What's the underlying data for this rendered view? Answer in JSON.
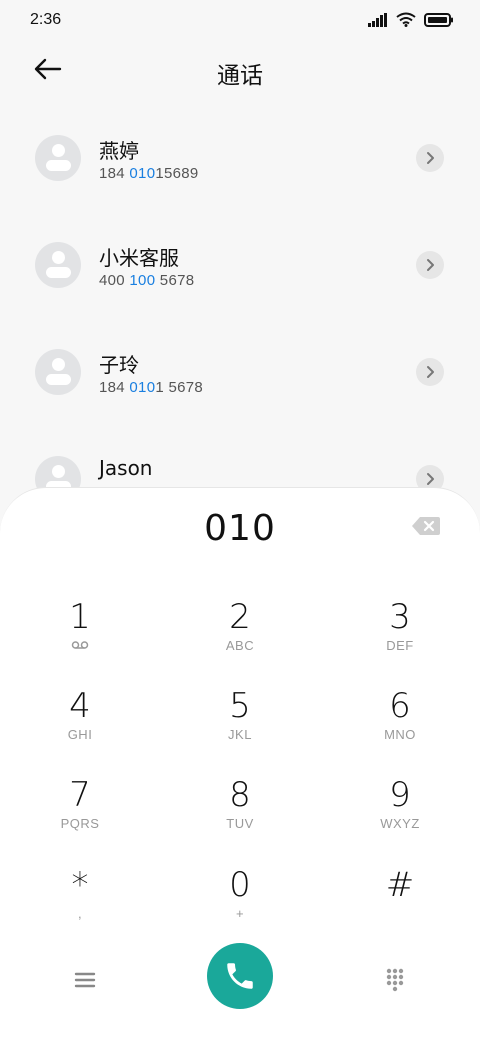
{
  "status_bar": {
    "time": "2:36"
  },
  "header": {
    "title": "通话"
  },
  "contacts": [
    {
      "name": "燕婷",
      "number_parts": [
        "184 ",
        "010",
        "15689"
      ]
    },
    {
      "name": "小米客服",
      "number_parts": [
        "400",
        " 100",
        " 5678"
      ]
    },
    {
      "name": "子玲",
      "number_parts": [
        "184 ",
        "010",
        "1 5678"
      ]
    },
    {
      "name": "Jason",
      "number_parts": [
        "",
        "",
        ""
      ]
    }
  ],
  "dialpad": {
    "dialed_number": "010",
    "keys": [
      {
        "digit": "1",
        "letters": ""
      },
      {
        "digit": "2",
        "letters": "ABC"
      },
      {
        "digit": "3",
        "letters": "DEF"
      },
      {
        "digit": "4",
        "letters": "GHI"
      },
      {
        "digit": "5",
        "letters": "JKL"
      },
      {
        "digit": "6",
        "letters": "MNO"
      },
      {
        "digit": "7",
        "letters": "PQRS"
      },
      {
        "digit": "8",
        "letters": "TUV"
      },
      {
        "digit": "9",
        "letters": "WXYZ"
      },
      {
        "digit": "*",
        "letters": ","
      },
      {
        "digit": "0",
        "letters": "+"
      },
      {
        "digit": "#",
        "letters": ""
      }
    ]
  },
  "colors": {
    "accent_call": "#1aa89a",
    "highlight_match": "#1a7fe0"
  },
  "icons": {
    "back": "back-arrow-icon",
    "detail": "chevron-right-icon",
    "backspace": "backspace-icon",
    "voicemail": "voicemail-icon",
    "menu": "menu-icon",
    "call": "phone-icon",
    "keypad": "dialpad-icon"
  }
}
